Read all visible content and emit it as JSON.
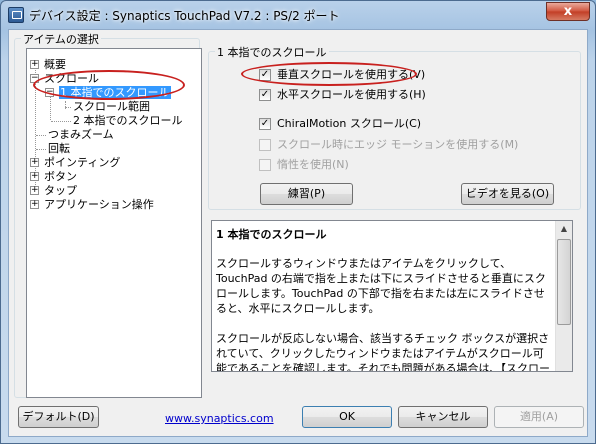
{
  "window": {
    "title": "デバイス設定 : Synaptics TouchPad V7.2 : PS/2 ポート",
    "close_glyph": "x"
  },
  "left_group": {
    "caption": "アイテムの選択"
  },
  "tree": {
    "items": [
      {
        "label": "概要",
        "expander": "+"
      },
      {
        "label": "スクロール",
        "expander": "−"
      },
      {
        "label": "1 本指でのスクロール",
        "expander": "−",
        "selected": true
      },
      {
        "label": "スクロール範囲"
      },
      {
        "label": "2 本指でのスクロール"
      },
      {
        "label": "つまみズーム"
      },
      {
        "label": "回転"
      },
      {
        "label": "ポインティング",
        "expander": "+"
      },
      {
        "label": "ボタン",
        "expander": "+"
      },
      {
        "label": "タップ",
        "expander": "+"
      },
      {
        "label": "アプリケーション操作",
        "expander": "+"
      }
    ]
  },
  "right_group": {
    "caption": "1 本指でのスクロール",
    "options": [
      {
        "label": "垂直スクロールを使用する(V)",
        "checked": true,
        "enabled": true
      },
      {
        "label": "水平スクロールを使用する(H)",
        "checked": true,
        "enabled": true
      },
      {
        "label": "ChiralMotion スクロール(C)",
        "checked": true,
        "enabled": true
      },
      {
        "label": "スクロール時にエッジ モーションを使用する(M)",
        "checked": false,
        "enabled": false
      },
      {
        "label": "惰性を使用(N)",
        "checked": false,
        "enabled": false
      }
    ],
    "practice_button": "練習(P)",
    "video_button": "ビデオを見る(O)"
  },
  "description": {
    "title": "1 本指でのスクロール",
    "paragraphs": [
      "スクロールするウィンドウまたはアイテムをクリックして、TouchPad の右端で指を上または下にスライドさせると垂直にスクロールします。TouchPad の下部で指を右または左にスライドさせると、水平にスクロールします。",
      "スクロールが反応しない場合、該当するチェック ボックスが選択されていて、クリックしたウィンドウまたはアイテムがスクロール可能であることを確認します。それでも問題がある場合は、【スクロール範囲】の設定を確認してください。"
    ]
  },
  "footer": {
    "default_button": "デフォルト(D)",
    "link": "www.synaptics.com",
    "ok_button": "OK",
    "cancel_button": "キャンセル",
    "apply_button": "適用(A)"
  },
  "annotation_color": "#c8201e",
  "selection_color": "#3399ff"
}
